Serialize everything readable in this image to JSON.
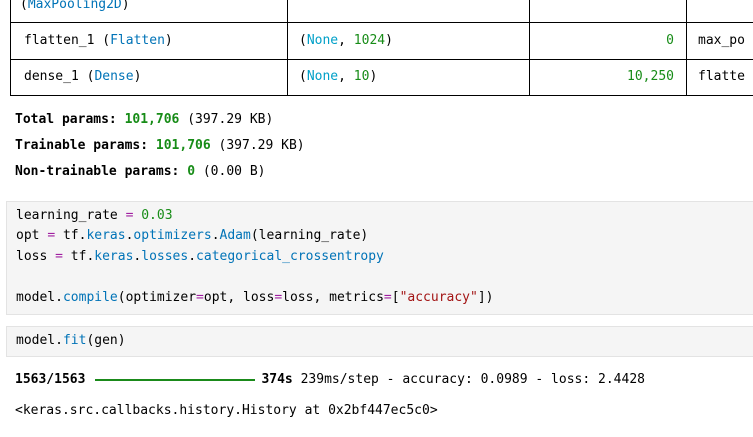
{
  "summary_table": {
    "rows": [
      {
        "name": "",
        "type": "MaxPooling2D",
        "shape_none": "",
        "shape_rest": "",
        "params": "",
        "connected": ""
      },
      {
        "name": "flatten_1",
        "type": "Flatten",
        "shape_none": "None",
        "shape_rest": "1024",
        "params": "0",
        "connected": "max_po"
      },
      {
        "name": "dense_1",
        "type": "Dense",
        "shape_none": "None",
        "shape_rest": "10",
        "params": "10,250",
        "connected": "flatte"
      }
    ]
  },
  "params": {
    "total_label": "Total params:",
    "total_value": "101,706",
    "total_size": "(397.29 KB)",
    "trainable_label": "Trainable params:",
    "trainable_value": "101,706",
    "trainable_size": "(397.29 KB)",
    "nontrainable_label": "Non-trainable params:",
    "nontrainable_value": "0",
    "nontrainable_size": "(0.00 B)"
  },
  "code_cell_1": {
    "line1": {
      "a": "learning_rate",
      "op": "=",
      "num": "0.03"
    },
    "line2": {
      "a": "opt",
      "op": "=",
      "b": "tf.",
      "mod1": "keras",
      "c": ".",
      "mod2": "optimizers",
      "d": ".",
      "mod3": "Adam",
      "e": "(learning_rate)"
    },
    "line3": {
      "a": "loss",
      "op": "=",
      "b": "tf.",
      "mod1": "keras",
      "c": ".",
      "mod2": "losses",
      "d": ".",
      "mod3": "categorical_crossentropy"
    },
    "line4": {
      "a": "model.",
      "fn": "compile",
      "b": "(optimizer",
      "op1": "=",
      "c": "opt, loss",
      "op2": "=",
      "d": "loss, metrics",
      "op3": "=",
      "br1": "[",
      "str": "\"accuracy\"",
      "br2": "]",
      "e": ")"
    }
  },
  "code_cell_2": {
    "a": "model.",
    "fn": "fit",
    "b": "(gen)"
  },
  "output": {
    "steps": "1563/1563",
    "time": "374s",
    "rest": "239ms/step - accuracy: 0.0989 - loss: 2.4428",
    "progress": 1.0,
    "result": "<keras.src.callbacks.history.History at 0x2bf447ec5c0>"
  }
}
